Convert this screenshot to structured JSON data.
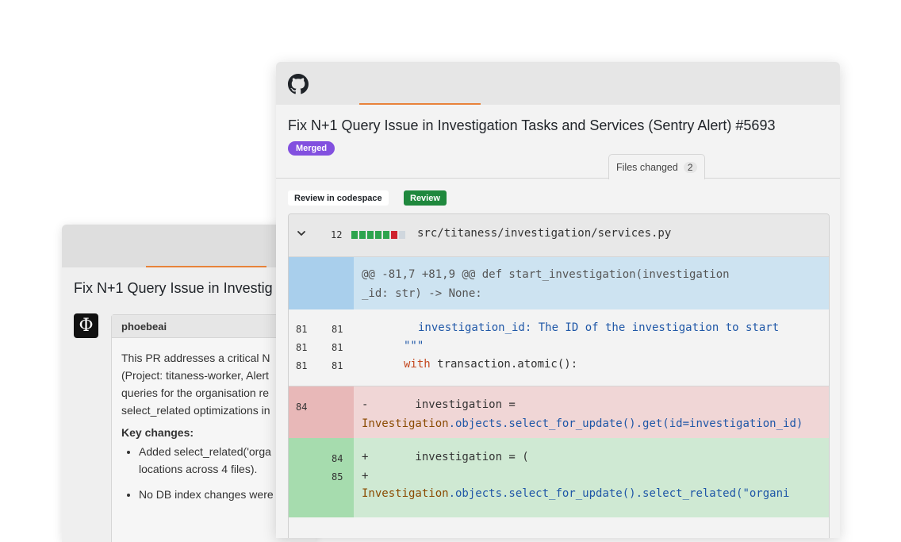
{
  "back_window": {
    "title": "Fix N+1 Query Issue in Investig",
    "avatar_glyph": "Φ",
    "comment": {
      "author": "phoebeai",
      "lines": [
        "This PR addresses a critical N",
        "(Project: titaness-worker, Alert",
        "queries for the organisation re",
        "select_related optimizations in"
      ],
      "key_changes_label": "Key changes:",
      "bullets": [
        {
          "line1": "Added select_related('orga",
          "line2": "locations across 4 files)."
        },
        {
          "line1": "No DB index changes were",
          "line2": ""
        }
      ]
    }
  },
  "front_window": {
    "logo_icon": "github-icon",
    "pr_title": "Fix N+1 Query Issue in Investigation Tasks and Services (Sentry Alert) #5693",
    "status_badge": "Merged",
    "tabs": {
      "files_changed_label": "Files changed",
      "files_changed_count": "2"
    },
    "actions": {
      "codespace_label": "Review in codespace",
      "review_label": "Review"
    },
    "file": {
      "change_count": "12",
      "diffstat": [
        "add",
        "add",
        "add",
        "add",
        "add",
        "del",
        "neutral"
      ],
      "path": "src/titaness/investigation/services.py",
      "hunk_header_line1": "@@ -81,7 +81,9 @@ def start_investigation(investigation",
      "hunk_header_line2": "_id: str) -> None:",
      "context_lines": [
        {
          "old": "81",
          "new": "81",
          "indent": "    ",
          "text": "investigation_id: The ID of the investigation to start"
        },
        {
          "old": "81",
          "new": "81",
          "text": "\"\"\""
        },
        {
          "old": "81",
          "new": "81",
          "kw": "with",
          "text": " transaction.atomic():"
        }
      ],
      "deleted": {
        "old": "84",
        "line1": "-       investigation =",
        "line2_class": "Investigation",
        "line2_rest": ".objects.select_for_update().get(id=investigation_id)"
      },
      "added": {
        "new1": "84",
        "new2": "85",
        "line1": "+       investigation = (",
        "line2": "+",
        "line3_class": "Investigation",
        "line3_rest": ".objects.select_for_update().select_related(\"organi"
      }
    }
  },
  "colors": {
    "merged": "#8250df",
    "review": "#1f883d",
    "accent_tab": "#e8833a",
    "diff_add": "#2da44e",
    "diff_del": "#cf222e"
  }
}
